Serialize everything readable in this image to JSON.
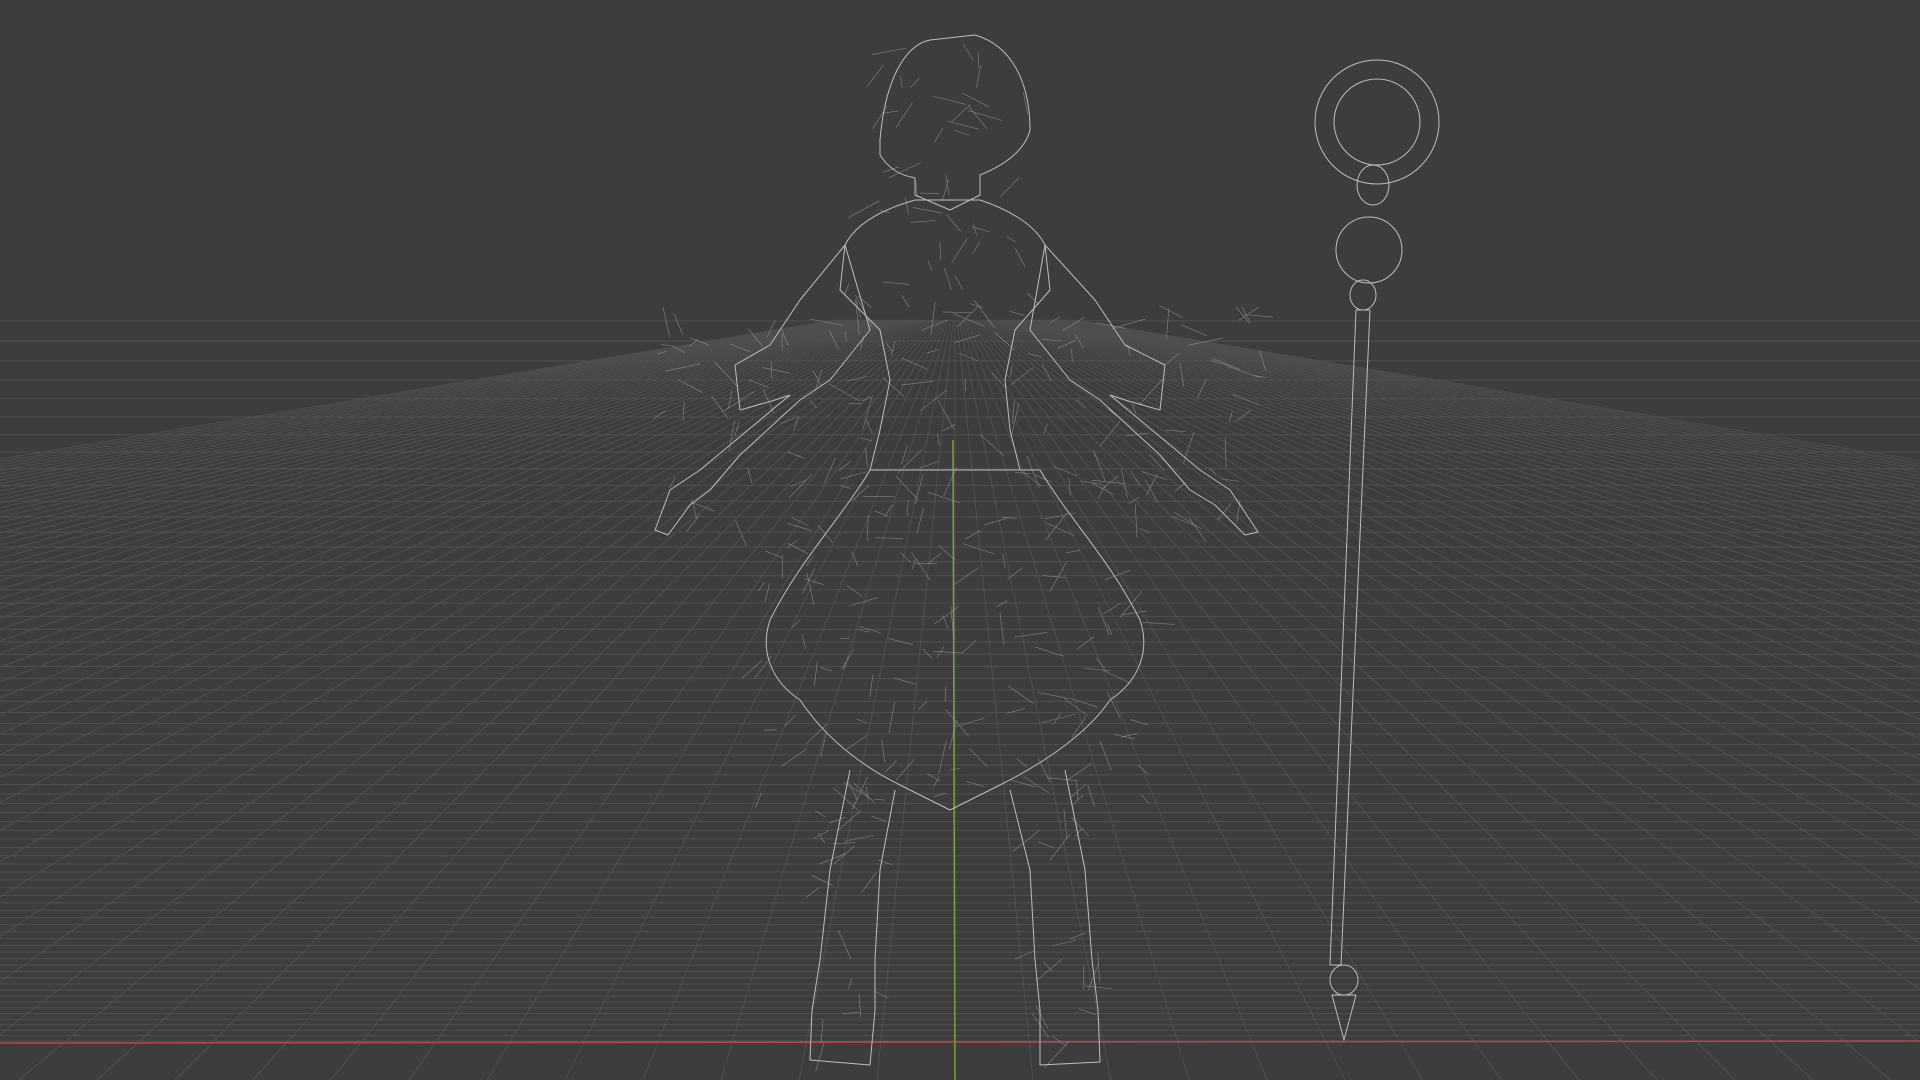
{
  "viewport": {
    "mode": "wireframe",
    "view": "front-perspective",
    "background_color": "#3d3d3d",
    "grid_color": "#4f4f4f",
    "x_axis_color": "#b8444c",
    "z_axis_color": "#7aa23a",
    "wire_color": "#bdbdbd"
  },
  "objects": [
    {
      "name": "character-wireframe"
    },
    {
      "name": "staff-wireframe"
    }
  ]
}
